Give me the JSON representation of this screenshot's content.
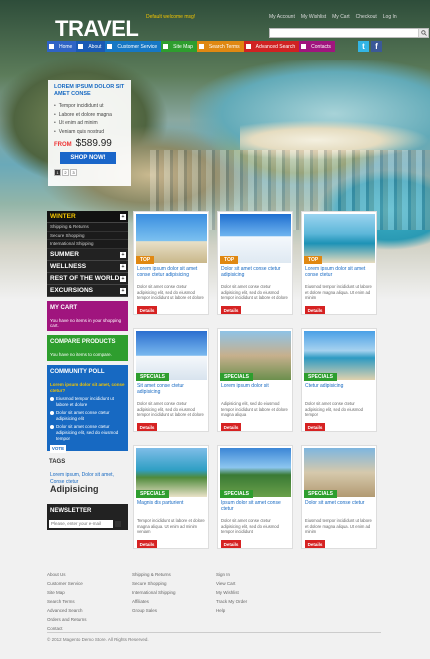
{
  "header": {
    "logo": "TRAVEL",
    "welcome": "Default welcome msg!",
    "top_links": [
      "My Account",
      "My Wishlist",
      "My Cart",
      "Checkout",
      "Log In"
    ]
  },
  "nav": [
    {
      "label": "Home",
      "color": "#2f63c6"
    },
    {
      "label": "About",
      "color": "#1a5ab5"
    },
    {
      "label": "Customer Service",
      "color": "#1677c4"
    },
    {
      "label": "Site Map",
      "color": "#2e9e2e"
    },
    {
      "label": "Search Terms",
      "color": "#e08812"
    },
    {
      "label": "Advanced Search",
      "color": "#d02222"
    },
    {
      "label": "Contacts",
      "color": "#a0157e"
    }
  ],
  "social": {
    "twitter": "t",
    "facebook": "f"
  },
  "promo": {
    "title": "LOREM IPSUM DOLOR SIT AMET CONSE",
    "bullets": [
      "Tempor incididunt ut",
      "Labore et dolore magna",
      "Ut enim ad minim",
      "Veniam quis nostrud"
    ],
    "from": "FROM",
    "price": "$589.99",
    "button": "SHOP NOW!",
    "pages": [
      "1",
      "2",
      "3"
    ]
  },
  "sidebar": {
    "categories": [
      {
        "label": "WINTER",
        "subs": [
          "Shipping & Returns",
          "Secure Shopping",
          "International Shipping"
        ]
      },
      {
        "label": "SUMMER"
      },
      {
        "label": "WELLNESS"
      },
      {
        "label": "REST OF THE WORLD"
      },
      {
        "label": "EXCURSIONS"
      }
    ],
    "cart": {
      "title": "MY CART",
      "text": "You have no items in your shopping cart.",
      "color": "#a0157e"
    },
    "compare": {
      "title": "COMPARE PRODUCTS",
      "text": "You have no items to compare.",
      "color": "#2e9e2e"
    },
    "poll": {
      "title": "COMMUNITY POLL",
      "question": "Lorem ipsum dolor sit amet, conse ctetur?",
      "options": [
        "Eiusmod tempor incididunt ut labore et dolore",
        "Dolor sit amet conse ctetur adipisicing elit",
        "Dolor sit amet conse ctetur adipisicing elit, sed do eiusmod tempor"
      ],
      "vote": "VOTE",
      "color": "#1769c2"
    },
    "tags": {
      "title": "TAGS",
      "text": "Lorem ipsum, Dolor sit amet, Conse ctetur",
      "big": "Adipisicing"
    },
    "newsletter": {
      "title": "NEWSLETTER",
      "placeholder": "Please, enter your e-mail"
    }
  },
  "products": [
    {
      "tag": "TOP",
      "tag_color": "#e08812",
      "title": "Lorem ipsum dolor sit amet conse ctetur adipisicing",
      "desc": "Dolor sit amet conse ctetur adipisicing elit, sed do eiusmod tempor incididunt ut labore et dolore",
      "button": "Details"
    },
    {
      "tag": "TOP",
      "tag_color": "#e08812",
      "title": "Dolor sit amet conse ctetur adipisicing",
      "desc": "Dolor sit amet conse ctetur adipisicing elit, sed do eiusmod tempor incididunt ut labore et dolore",
      "button": "Details"
    },
    {
      "tag": "TOP",
      "tag_color": "#e08812",
      "title": "Lorem ipsum dolor sit amet conse ctetur",
      "desc": "Eiusmod tempor incididunt ut labore et dolore magna aliqua. Ut enim ad minim",
      "button": "Details"
    },
    {
      "tag": "SPECIALS",
      "tag_color": "#2e9e2e",
      "title": "Sit amet conse ctetur adipisicing",
      "desc": "Dolor sit amet conse ctetur adipisicing elit, sed do eiusmod tempor incididunt ut labore et dolore",
      "button": "Details"
    },
    {
      "tag": "SPECIALS",
      "tag_color": "#2e9e2e",
      "title": "Lorem ipsum dolor sit",
      "desc": "Adipisicing elit, sed do eiusmod tempor incididunt ut labore et dolore magna aliqua",
      "button": "Details"
    },
    {
      "tag": "SPECIALS",
      "tag_color": "#2e9e2e",
      "title": "Ctetur adipisicing",
      "desc": "Dolor sit amet conse ctetur adipisicing elit, sed do eiusmod tempor",
      "button": "Details"
    },
    {
      "tag": "SPECIALS",
      "tag_color": "#2e9e2e",
      "title": "Magnis dis parturient",
      "desc": "Tempor incididunt ut labore et dolore magna aliqua. Ut enim ad minim veniam",
      "button": "Details"
    },
    {
      "tag": "SPECIALS",
      "tag_color": "#2e9e2e",
      "title": "Ipsum dolor sit amet conse ctetur",
      "desc": "Dolor sit amet conse ctetur adipisicing elit, sed do eiusmod tempor incididunt",
      "button": "Details"
    },
    {
      "tag": "SPECIALS",
      "tag_color": "#2e9e2e",
      "title": "Dolor sit amet conse ctetur",
      "desc": "Eiusmod tempor incididunt ut labore et dolore magna aliqua. Ut enim ad minim",
      "button": "Details"
    }
  ],
  "footer": {
    "col1": [
      "About Us",
      "Customer Service",
      "Site Map",
      "Search Terms",
      "Advanced Search",
      "Orders and Returns",
      "Contact"
    ],
    "col2": [
      "Shipping & Returns",
      "Secure Shopping",
      "International Shipping",
      "Affiliates",
      "Group Sales"
    ],
    "col3": [
      "Sign In",
      "View Cart",
      "My Wishlist",
      "Track My Order",
      "Help"
    ],
    "copyright": "© 2012 Magento Demo Store. All Rights Reserved."
  }
}
